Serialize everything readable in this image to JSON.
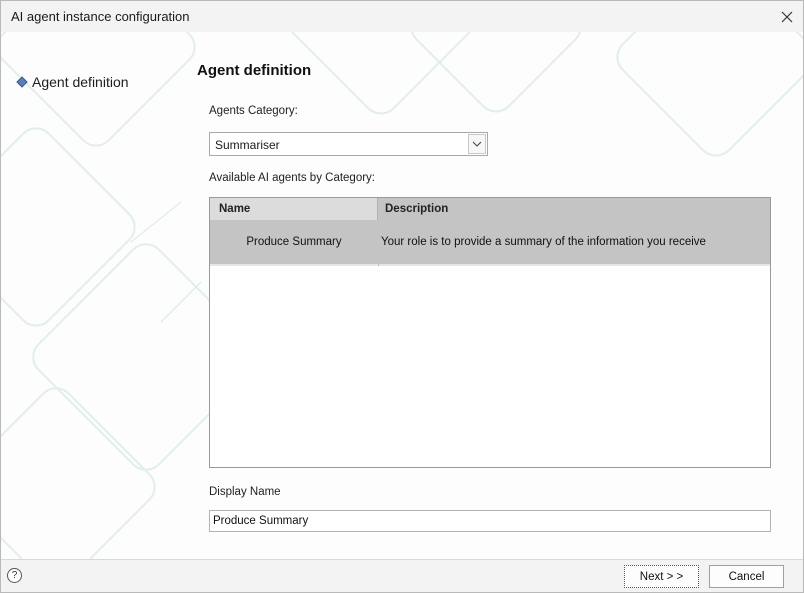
{
  "window": {
    "title": "AI agent instance configuration",
    "close_icon": "close-icon"
  },
  "nav": {
    "items": [
      {
        "label": "Agent definition",
        "icon": "diamond-bullet-icon",
        "active": true
      }
    ]
  },
  "main": {
    "section_title": "Agent definition",
    "category": {
      "label": "Agents Category:",
      "value": "Summariser",
      "dropdown_icon": "chevron-down-icon"
    },
    "agents_table": {
      "label": "Available AI agents by Category:",
      "columns": [
        "Name",
        "Description"
      ],
      "rows": [
        {
          "name": "Produce Summary",
          "description": "Your role is to provide a summary of the information you receive",
          "selected": true
        }
      ]
    },
    "display_name": {
      "label": "Display Name",
      "value": "Produce Summary"
    }
  },
  "footer": {
    "help_label": "?",
    "help_icon": "help-icon",
    "next_label": "Next > >",
    "cancel_label": "Cancel"
  },
  "colors": {
    "selected_row": "#c4c4c4",
    "header_name_bg": "#dcdcdc",
    "nav_bullet": "#5a7fb6",
    "background_deco": "#e4f1e9"
  }
}
